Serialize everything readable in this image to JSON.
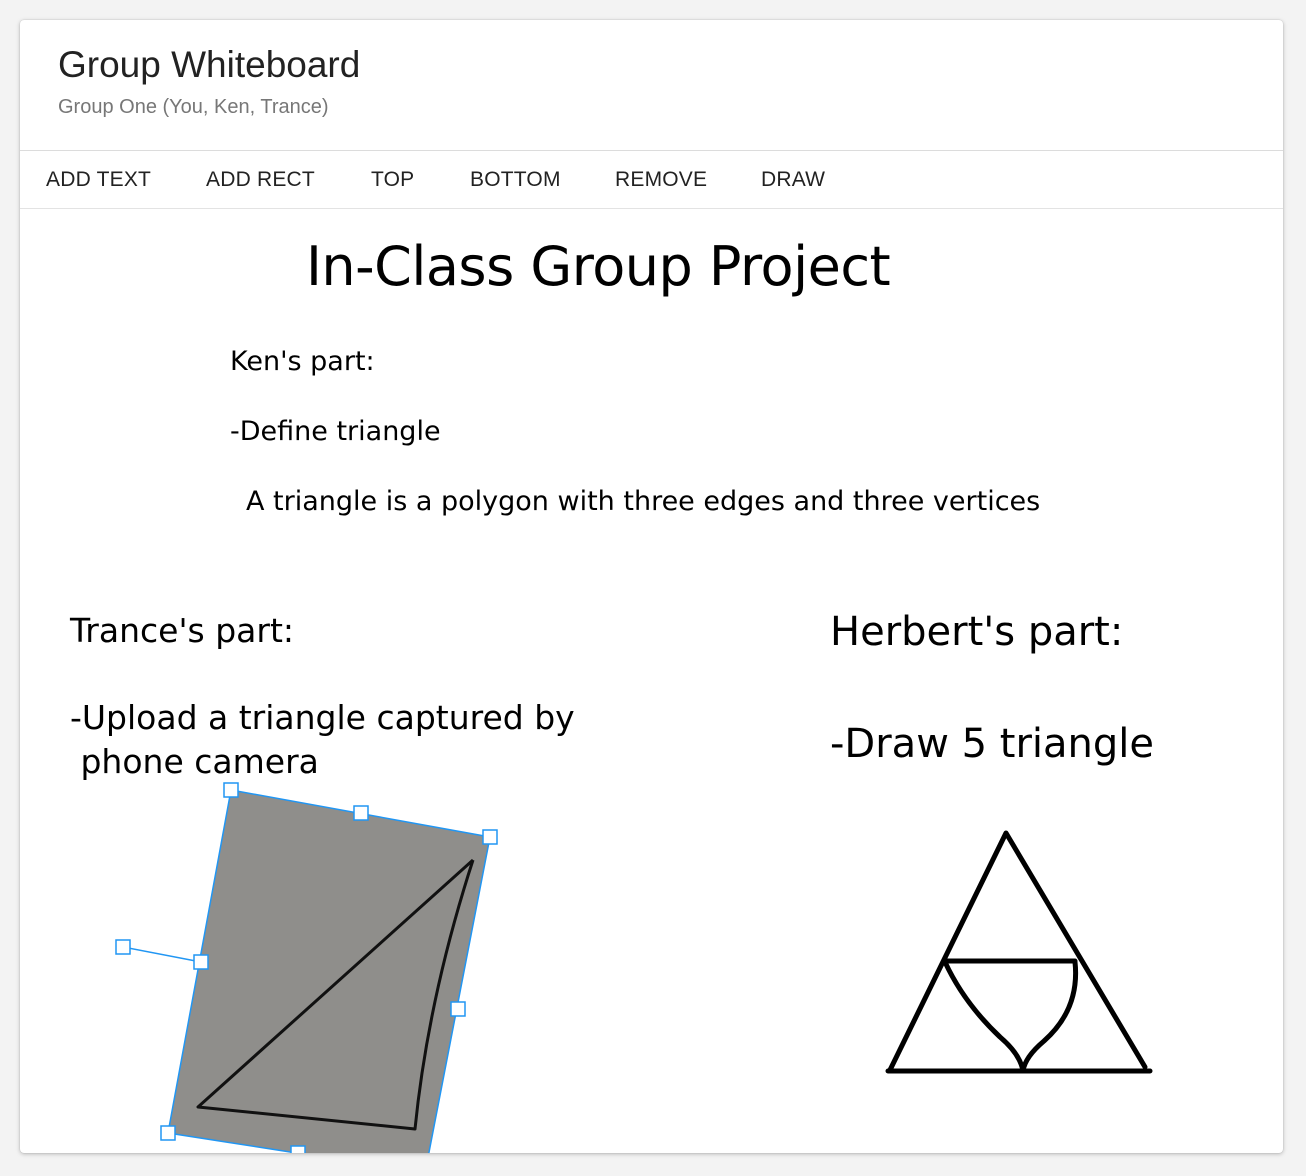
{
  "header": {
    "title": "Group Whiteboard",
    "subtitle": "Group One (You, Ken, Trance)"
  },
  "toolbar": {
    "add_text": "ADD TEXT",
    "add_rect": "ADD RECT",
    "top": "TOP",
    "bottom": "BOTTOM",
    "remove": "REMOVE",
    "draw": "DRAW"
  },
  "canvas": {
    "project_title": "In-Class Group Project",
    "ken": {
      "label": "Ken's part:",
      "task": "-Define triangle",
      "definition": "A triangle is a polygon with three edges and three vertices"
    },
    "trance": {
      "label": "Trance's part:",
      "task": "-Upload a triangle captured by\n phone camera"
    },
    "herbert": {
      "label": "Herbert's part:",
      "task": "-Draw 5 triangle"
    },
    "photo_icon": "triangle-photo",
    "sketch_icon": "triforce-sketch",
    "selection_color": "#2196f3"
  }
}
